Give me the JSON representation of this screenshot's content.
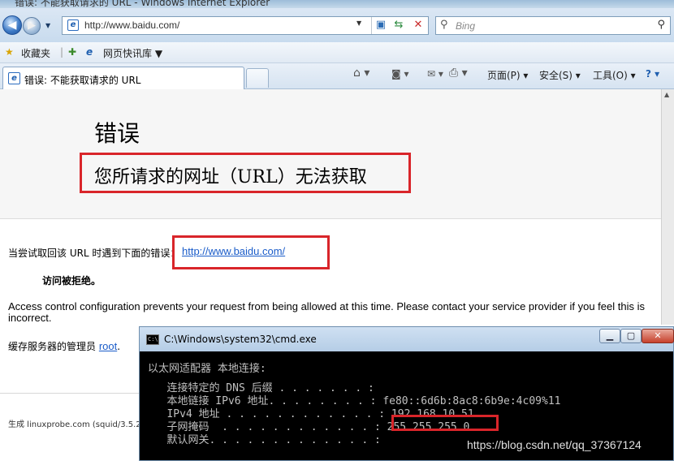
{
  "window": {
    "title": "错误: 不能获取请求的 URL - Windows Internet Explorer"
  },
  "navbar": {
    "back_glyph": "◀",
    "forward_glyph": "▶",
    "address": "http://www.baidu.com/",
    "search_placeholder": "Bing",
    "search_glyph": "⚲",
    "go_glyph": "⚲",
    "refresh_glyph": "⇆",
    "stop_glyph": "✕",
    "compat_glyph": "▣"
  },
  "favorites": {
    "favorites_label": "收藏夹",
    "quicklinks_label": "网页快讯库 ▼",
    "star_glyph": "★",
    "add_glyph": "✚"
  },
  "tab": {
    "title": "错误: 不能获取请求的 URL"
  },
  "commandbar": {
    "home_glyph": "⌂ ▾",
    "feeds_glyph": "◙ ▾",
    "mail_glyph": "✉ ▾",
    "print_glyph": "⎙ ▾",
    "page": "页面(P) ▾",
    "safety": "安全(S) ▾",
    "tools": "工具(O) ▾",
    "help_glyph": "? ▾"
  },
  "page": {
    "heading": "错误",
    "subheading": "您所请求的网址（URL）无法获取",
    "attempt_text": "当尝试取回该  URL 时遇到下面的错误：",
    "url_link": "http://www.baidu.com/",
    "denied": "访问被拒绝。",
    "access_msg": "Access control configuration prevents your request from being allowed at this time. Please contact your service provider if you feel this is incorrect.",
    "admin_text": "缓存服务器的管理员 ",
    "admin_link": "root",
    "admin_suffix": ".",
    "footer": "生成 linuxprobe.com (squid/3.5.2"
  },
  "cmd": {
    "title": "C:\\Windows\\system32\\cmd.exe",
    "icon_text": "C:\\",
    "min_glyph": "▁",
    "max_glyph": "▢",
    "close_glyph": "✕",
    "lines": [
      "以太网适配器 本地连接:",
      "",
      "   连接特定的 DNS 后缀 . . . . . . . :",
      "   本地链接 IPv6 地址. . . . . . . . : fe80::6d6b:8ac8:6b9e:4c09%11",
      "   IPv4 地址 . . . . . . . . . . . . : 192.168.10.51",
      "   子网掩码  . . . . . . . . . . . . : 255.255.255.0",
      "   默认网关. . . . . . . . . . . . . :"
    ]
  },
  "watermark": "https://blog.csdn.net/qq_37367124",
  "colors": {
    "highlight": "#d9252a",
    "link": "#1a5cc9"
  }
}
